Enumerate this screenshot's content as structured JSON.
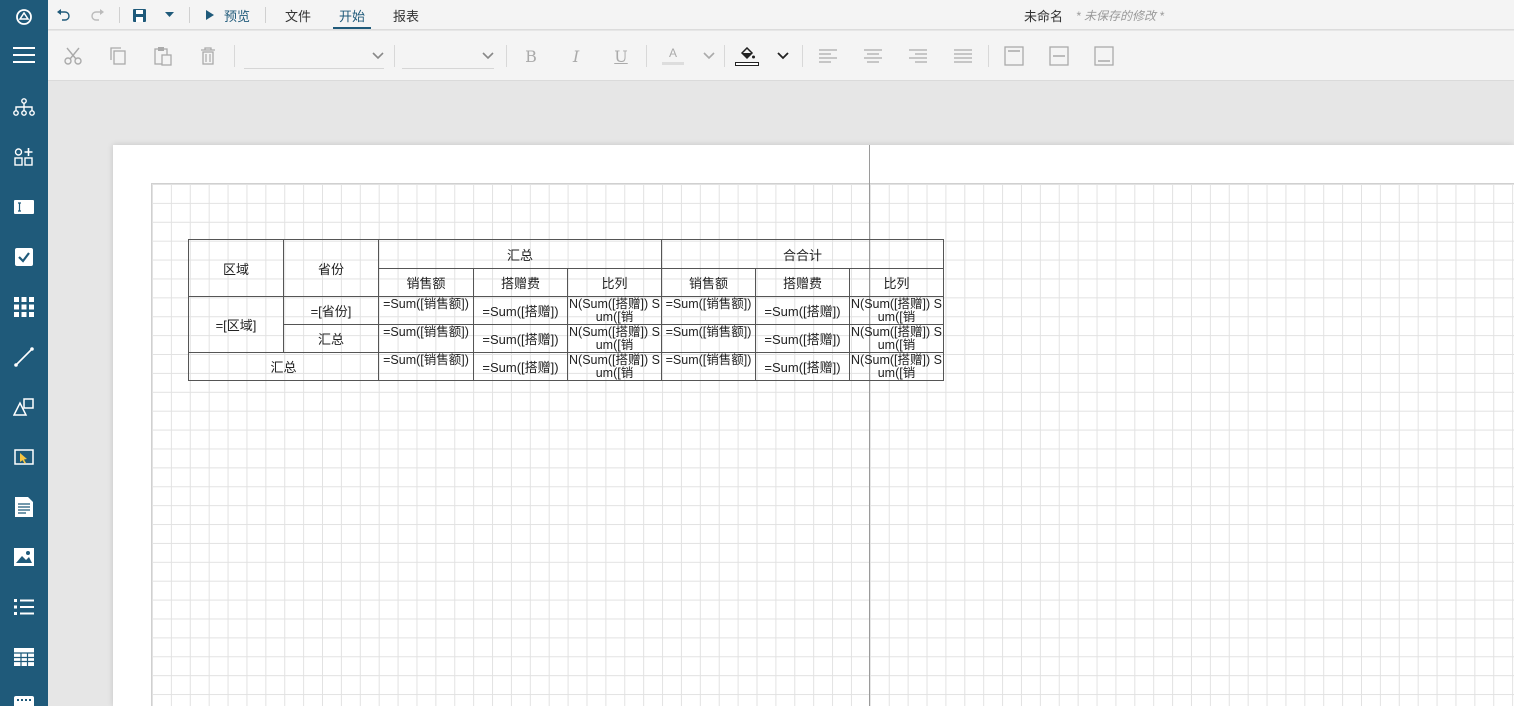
{
  "menubar": {
    "preview_label": "预览",
    "menus": [
      "文件",
      "开始",
      "报表"
    ],
    "active_tab": "开始",
    "doc_name": "未命名",
    "unsaved_note": "* 未保存的修改 *"
  },
  "toolbar": {
    "font_family_value": "",
    "font_size_value": "",
    "bold_label": "B",
    "italic_label": "I",
    "underline_label": "U",
    "font_color_label": "A"
  },
  "sidebar": {
    "items": [
      "logo-icon",
      "menu-icon",
      "hierarchy-icon",
      "component-icon",
      "textbox-icon",
      "checkbox-icon",
      "table-grid-icon",
      "line-icon",
      "shapes-icon",
      "select-icon",
      "document-icon",
      "image-icon",
      "list-icon",
      "table-icon",
      "keyboard-icon"
    ]
  },
  "table": {
    "header1": {
      "region": "区域",
      "province": "省份",
      "group1": "汇总",
      "group2": "合合计"
    },
    "header2": [
      "销售额",
      "搭赠费",
      "比列",
      "销售额",
      "搭赠费",
      "比列"
    ],
    "row1": {
      "region": "=[区域]",
      "province": "=[省份]",
      "cells": [
        "=Sum([销售额])",
        "=Sum([搭赠])",
        "N(Sum([搭赠]) Sum([销",
        "=Sum([销售额])",
        "=Sum([搭赠])",
        "N(Sum([搭赠]) Sum([销"
      ]
    },
    "row2": {
      "province": "汇总",
      "cells": [
        "=Sum([销售额])",
        "=Sum([搭赠])",
        "N(Sum([搭赠]) Sum([销",
        "=Sum([销售额])",
        "=Sum([搭赠])",
        "N(Sum([搭赠]) Sum([销"
      ]
    },
    "row3": {
      "label": "汇总",
      "cells": [
        "=Sum([销售额])",
        "=Sum([搭赠])",
        "N(Sum([搭赠]) Sum([销",
        "=Sum([销售额])",
        "=Sum([搭赠])",
        "N(Sum([搭赠]) Sum([销"
      ]
    }
  },
  "colors": {
    "sidebar": "#1f5a7a",
    "accent": "#1f5a7a"
  }
}
